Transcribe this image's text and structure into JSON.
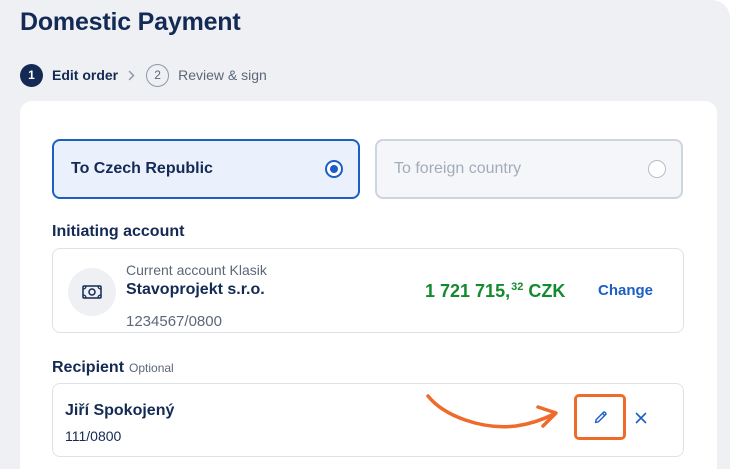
{
  "page": {
    "title": "Domestic Payment"
  },
  "stepper": {
    "steps": [
      {
        "number": "1",
        "label": "Edit order",
        "state": "active"
      },
      {
        "number": "2",
        "label": "Review & sign",
        "state": "inactive"
      }
    ]
  },
  "destination": {
    "options": [
      {
        "label": "To Czech Republic",
        "selected": true
      },
      {
        "label": "To foreign country",
        "selected": false
      }
    ]
  },
  "initiating_account": {
    "label": "Initiating account",
    "account_type": "Current account Klasik",
    "account_name": "Stavoprojekt s.r.o.",
    "account_number": "1234567/0800",
    "balance_whole": "1 721 715,",
    "balance_decimal": "32",
    "balance_currency": "CZK",
    "change_label": "Change",
    "icon": "banknote-icon"
  },
  "recipient": {
    "label": "Recipient",
    "optional_label": "Optional",
    "name": "Jiří Spokojený",
    "account_number": "111/0800",
    "edit_icon": "pencil-icon",
    "remove_icon": "close-icon"
  },
  "colors": {
    "primary": "#132a55",
    "accent": "#1c5fc4",
    "balance": "#148a2e",
    "highlight": "#ef6b2c",
    "background": "#eef0f4"
  }
}
